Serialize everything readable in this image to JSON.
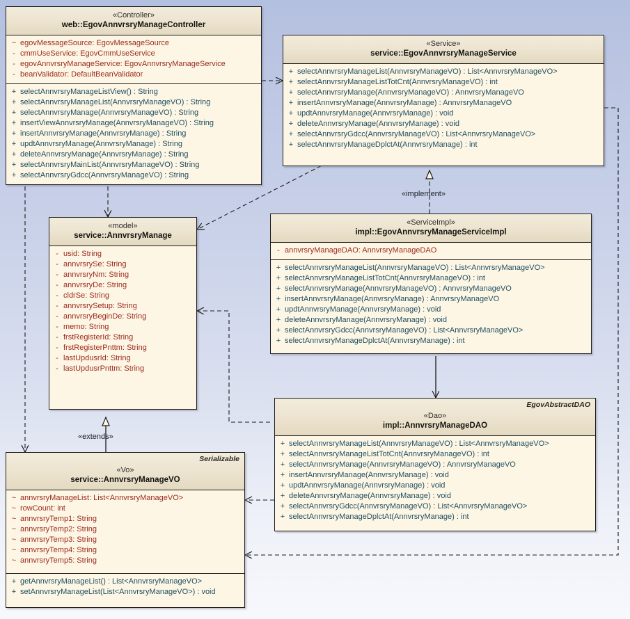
{
  "diagram": {
    "title": "EgovAnnvrsryManage UML Class Diagram",
    "background_top": "#b4c0e0",
    "background_bottom": "#f7f8fc",
    "class_fill": "#fdf6e4",
    "header_fill": "#e7ddc6",
    "attribute_color": "#9c2a20",
    "operation_color": "#1f4f63",
    "border_color": "#1a1a1a"
  },
  "classes": {
    "controller": {
      "stereotype": "«Controller»",
      "name": "web::EgovAnnvrsryManageController",
      "attributes": [
        {
          "vis": "~",
          "text": "egovMessageSource:  EgovMessageSource"
        },
        {
          "vis": "-",
          "text": "cmmUseService:  EgovCmmUseService"
        },
        {
          "vis": "-",
          "text": "egovAnnvrsryManageService:  EgovAnnvrsryManageService"
        },
        {
          "vis": "-",
          "text": "beanValidator:  DefaultBeanValidator"
        }
      ],
      "operations": [
        {
          "vis": "+",
          "text": "selectAnnvrsryManageListView() : String"
        },
        {
          "vis": "+",
          "text": "selectAnnvrsryManageList(AnnvrsryManageVO) : String"
        },
        {
          "vis": "+",
          "text": "selectAnnvrsryManage(AnnvrsryManageVO) : String"
        },
        {
          "vis": "+",
          "text": "insertViewAnnvrsryManage(AnnvrsryManageVO) : String"
        },
        {
          "vis": "+",
          "text": "insertAnnvrsryManage(AnnvrsryManage) : String"
        },
        {
          "vis": "+",
          "text": "updtAnnvrsryManage(AnnvrsryManage) : String"
        },
        {
          "vis": "+",
          "text": "deleteAnnvrsryManage(AnnvrsryManage) : String"
        },
        {
          "vis": "+",
          "text": "selectAnnvrsryMainList(AnnvrsryManageVO) : String"
        },
        {
          "vis": "+",
          "text": "selectAnnvrsryGdcc(AnnvrsryManageVO) : String"
        }
      ]
    },
    "service": {
      "stereotype": "«Service»",
      "name": "service::EgovAnnvrsryManageService",
      "attributes": [],
      "operations": [
        {
          "vis": "+",
          "text": "selectAnnvrsryManageList(AnnvrsryManageVO) : List<AnnvrsryManageVO>"
        },
        {
          "vis": "+",
          "text": "selectAnnvrsryManageListTotCnt(AnnvrsryManageVO) : int"
        },
        {
          "vis": "+",
          "text": "selectAnnvrsryManage(AnnvrsryManageVO) : AnnvrsryManageVO"
        },
        {
          "vis": "+",
          "text": "insertAnnvrsryManage(AnnvrsryManage) : AnnvrsryManageVO"
        },
        {
          "vis": "+",
          "text": "updtAnnvrsryManage(AnnvrsryManage) : void"
        },
        {
          "vis": "+",
          "text": "deleteAnnvrsryManage(AnnvrsryManage) : void"
        },
        {
          "vis": "+",
          "text": "selectAnnvrsryGdcc(AnnvrsryManageVO) : List<AnnvrsryManageVO>"
        },
        {
          "vis": "+",
          "text": "selectAnnvrsryManageDplctAt(AnnvrsryManage) : int"
        }
      ]
    },
    "model": {
      "stereotype": "«model»",
      "name": "service::AnnvrsryManage",
      "attributes": [
        {
          "vis": "-",
          "text": "usid:  String"
        },
        {
          "vis": "-",
          "text": "annvrsrySe:  String"
        },
        {
          "vis": "-",
          "text": "annvrsryNm:  String"
        },
        {
          "vis": "-",
          "text": "annvrsryDe:  String"
        },
        {
          "vis": "-",
          "text": "cldrSe:  String"
        },
        {
          "vis": "-",
          "text": "annvrsrySetup:  String"
        },
        {
          "vis": "-",
          "text": "annvrsryBeginDe:  String"
        },
        {
          "vis": "-",
          "text": "memo:  String"
        },
        {
          "vis": "-",
          "text": "frstRegisterId:  String"
        },
        {
          "vis": "-",
          "text": "frstRegisterPnttm:  String"
        },
        {
          "vis": "-",
          "text": "lastUpdusrId:  String"
        },
        {
          "vis": "-",
          "text": "lastUpdusrPnttm:  String"
        }
      ],
      "operations": []
    },
    "serviceimpl": {
      "stereotype": "«ServiceImpl»",
      "name": "impl::EgovAnnvrsryManageServiceImpl",
      "attributes": [
        {
          "vis": "-",
          "text": "annvrsryManageDAO:  AnnvrsryManageDAO"
        }
      ],
      "operations": [
        {
          "vis": "+",
          "text": "selectAnnvrsryManageList(AnnvrsryManageVO) : List<AnnvrsryManageVO>"
        },
        {
          "vis": "+",
          "text": "selectAnnvrsryManageListTotCnt(AnnvrsryManageVO) : int"
        },
        {
          "vis": "+",
          "text": "selectAnnvrsryManage(AnnvrsryManageVO) : AnnvrsryManageVO"
        },
        {
          "vis": "+",
          "text": "insertAnnvrsryManage(AnnvrsryManage) : AnnvrsryManageVO"
        },
        {
          "vis": "+",
          "text": "updtAnnvrsryManage(AnnvrsryManage) : void"
        },
        {
          "vis": "+",
          "text": "deleteAnnvrsryManage(AnnvrsryManage) : void"
        },
        {
          "vis": "+",
          "text": "selectAnnvrsryGdcc(AnnvrsryManageVO) : List<AnnvrsryManageVO>"
        },
        {
          "vis": "+",
          "text": "selectAnnvrsryManageDplctAt(AnnvrsryManage) : int"
        }
      ]
    },
    "dao": {
      "corner_tag": "EgovAbstractDAO",
      "stereotype": "«Dao»",
      "name": "impl::AnnvrsryManageDAO",
      "attributes": [],
      "operations": [
        {
          "vis": "+",
          "text": "selectAnnvrsryManageList(AnnvrsryManageVO) : List<AnnvrsryManageVO>"
        },
        {
          "vis": "+",
          "text": "selectAnnvrsryManageListTotCnt(AnnvrsryManageVO) : int"
        },
        {
          "vis": "+",
          "text": "selectAnnvrsryManage(AnnvrsryManageVO) : AnnvrsryManageVO"
        },
        {
          "vis": "+",
          "text": "insertAnnvrsryManage(AnnvrsryManage) : void"
        },
        {
          "vis": "+",
          "text": "updtAnnvrsryManage(AnnvrsryManage) : void"
        },
        {
          "vis": "+",
          "text": "deleteAnnvrsryManage(AnnvrsryManage) : void"
        },
        {
          "vis": "+",
          "text": "selectAnnvrsryGdcc(AnnvrsryManageVO) : List<AnnvrsryManageVO>"
        },
        {
          "vis": "+",
          "text": "selectAnnvrsryManageDplctAt(AnnvrsryManage) : int"
        }
      ]
    },
    "vo": {
      "corner_tag": "Serializable",
      "stereotype": "«Vo»",
      "name": "service::AnnvrsryManageVO",
      "attributes": [
        {
          "vis": "~",
          "text": "annvrsryManageList:  List<AnnvrsryManageVO>"
        },
        {
          "vis": "~",
          "text": "rowCount:  int"
        },
        {
          "vis": "~",
          "text": "annvrsryTemp1:  String"
        },
        {
          "vis": "~",
          "text": "annvrsryTemp2:  String"
        },
        {
          "vis": "~",
          "text": "annvrsryTemp3:  String"
        },
        {
          "vis": "~",
          "text": "annvrsryTemp4:  String"
        },
        {
          "vis": "~",
          "text": "annvrsryTemp5:  String"
        }
      ],
      "operations": [
        {
          "vis": "+",
          "text": "getAnnvrsryManageList() : List<AnnvrsryManageVO>"
        },
        {
          "vis": "+",
          "text": "setAnnvrsryManageList(List<AnnvrsryManageVO>) : void"
        }
      ]
    }
  },
  "relationships": [
    {
      "id": "controller-to-service",
      "label": "",
      "kind": "dependency",
      "from": "controller",
      "to": "service"
    },
    {
      "id": "controller-to-model",
      "label": "",
      "kind": "dependency",
      "from": "controller",
      "to": "model"
    },
    {
      "id": "controller-to-vo",
      "label": "",
      "kind": "dependency",
      "from": "controller",
      "to": "vo"
    },
    {
      "id": "service-to-model",
      "label": "",
      "kind": "dependency",
      "from": "service",
      "to": "model"
    },
    {
      "id": "service-to-vo",
      "label": "",
      "kind": "dependency",
      "from": "service",
      "to": "vo"
    },
    {
      "id": "serviceimpl-implements-service",
      "label": "«implement»",
      "kind": "realization",
      "from": "serviceimpl",
      "to": "service"
    },
    {
      "id": "serviceimpl-to-dao",
      "label": "",
      "kind": "association",
      "from": "serviceimpl",
      "to": "dao"
    },
    {
      "id": "serviceimpl-to-model",
      "label": "",
      "kind": "dependency",
      "from": "serviceimpl",
      "to": "model"
    },
    {
      "id": "dao-to-vo",
      "label": "",
      "kind": "dependency",
      "from": "dao",
      "to": "vo"
    },
    {
      "id": "vo-extends-model",
      "label": "«extends»",
      "kind": "generalization",
      "from": "vo",
      "to": "model"
    }
  ]
}
